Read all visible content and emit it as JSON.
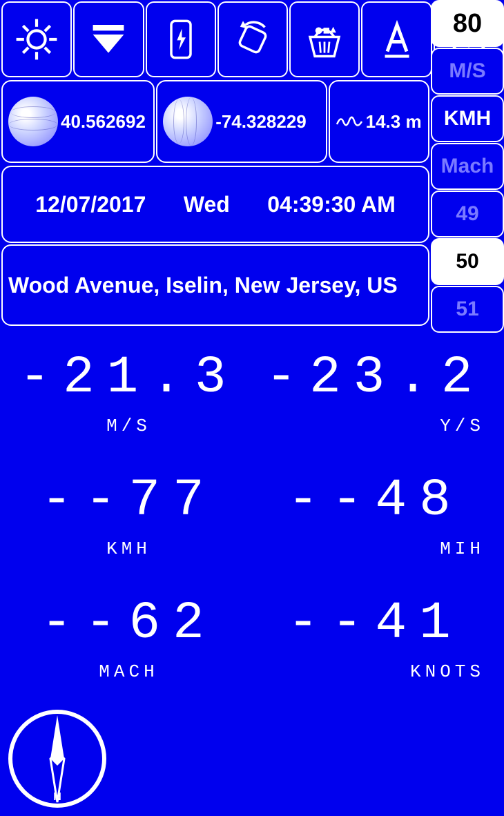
{
  "side": {
    "top": "80",
    "units": [
      "M/S",
      "KMH",
      "Mach"
    ],
    "active_unit": "KMH",
    "picker": [
      "49",
      "50",
      "51"
    ],
    "picker_active": "50"
  },
  "gps": {
    "lat": "40.562692",
    "lon": "-74.328229",
    "alt": "14.3 m"
  },
  "datetime": {
    "date": "12/07/2017",
    "day": "Wed",
    "time": "04:39:30 AM"
  },
  "address": "Wood Avenue, Iselin, New Jersey, US",
  "readouts": [
    {
      "left": {
        "value": "-21.3",
        "unit": "M/S"
      },
      "right": {
        "value": "-23.2",
        "unit": "Y/S"
      }
    },
    {
      "left": {
        "value": "--77",
        "unit": "KMH"
      },
      "right": {
        "value": "--48",
        "unit": "MIH"
      }
    },
    {
      "left": {
        "value": "--62",
        "unit": "MACH"
      },
      "right": {
        "value": "--41",
        "unit": "KNOTS"
      }
    }
  ]
}
